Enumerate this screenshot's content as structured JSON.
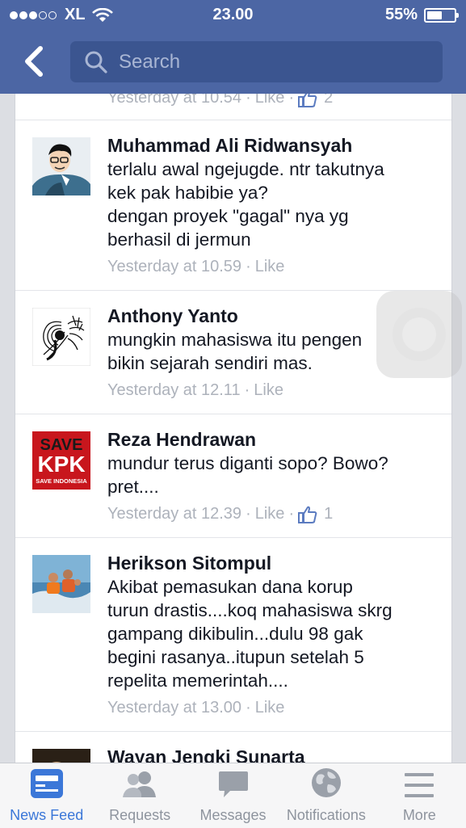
{
  "status_bar": {
    "carrier": "XL",
    "time": "23.00",
    "battery": "55%",
    "battery_fraction": 0.55,
    "signal_bars_filled": 3,
    "signal_bars_total": 5
  },
  "search": {
    "placeholder": "Search"
  },
  "previous_comment": {
    "time": "Yesterday at 10.54",
    "like": "Like",
    "like_count": "2"
  },
  "comments": [
    {
      "name": "Muhammad Ali Ridwansyah",
      "text": "terlalu awal ngejugde. ntr takutnya\nkek pak habibie ya?\ndengan proyek \"gagal\" nya yg\nberhasil di jermun",
      "time": "Yesterday at 10.59",
      "like": "Like"
    },
    {
      "name": "Anthony Yanto",
      "text": "mungkin mahasiswa itu pengen\nbikin sejarah sendiri mas.",
      "time": "Yesterday at 12.11",
      "like": "Like"
    },
    {
      "name": "Reza Hendrawan",
      "text": "mundur terus diganti sopo? Bowo?\npret....",
      "time": "Yesterday at 12.39",
      "like": "Like",
      "like_count": "1",
      "avatar_text": {
        "top": "SAVE",
        "big": "KPK",
        "bottom": "SAVE INDONESIA"
      }
    },
    {
      "name": "Herikson Sitompul",
      "text": "Akibat pemasukan dana korup\nturun drastis....koq mahasiswa skrg\ngampang dikibulin...dulu 98 gak\nbegini rasanya..itupun setelah 5\nrepelita memerintah....",
      "time": "Yesterday at 13.00",
      "like": "Like"
    },
    {
      "name": "Wayan Jengki Sunarta"
    }
  ],
  "tabs": [
    {
      "label": "News Feed",
      "icon": "news-feed-icon",
      "active": true
    },
    {
      "label": "Requests",
      "icon": "friends-icon"
    },
    {
      "label": "Messages",
      "icon": "message-bubble-icon"
    },
    {
      "label": "Notifications",
      "icon": "globe-icon"
    },
    {
      "label": "More",
      "icon": "menu-lines-icon"
    }
  ],
  "colors": {
    "header": "#4c66a4",
    "search_bg": "#3b5590",
    "active_tab": "#3b77d8",
    "meta_gray": "#adb2bb"
  }
}
